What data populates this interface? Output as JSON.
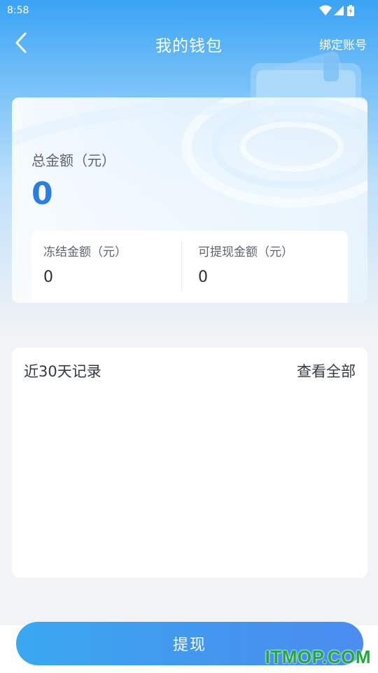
{
  "status_bar": {
    "time": "8:58"
  },
  "nav": {
    "title": "我的钱包",
    "right_action": "绑定账号"
  },
  "balance": {
    "total_label": "总金额（元）",
    "total_value": "0",
    "frozen_label": "冻结金额（元）",
    "frozen_value": "0",
    "withdrawable_label": "可提现金额（元）",
    "withdrawable_value": "0"
  },
  "records": {
    "title": "近30天记录",
    "view_all": "查看全部"
  },
  "action": {
    "withdraw_label": "提现"
  },
  "watermark": "ITMOP.COM",
  "colors": {
    "accent": "#2a7de1",
    "button": "#4495ee",
    "header": "#3aa3f5"
  }
}
